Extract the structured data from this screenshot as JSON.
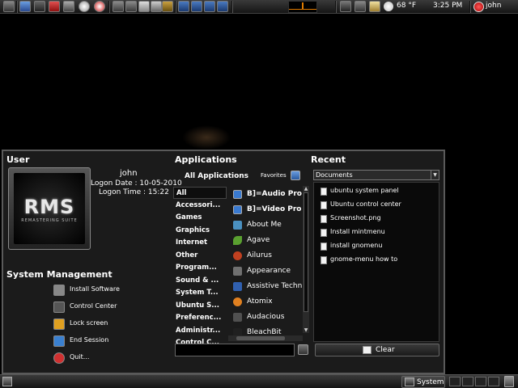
{
  "top_panel": {
    "icons": [
      "launcher-icon",
      "firefox-icon",
      "terminal-icon",
      "pdf-icon",
      "monitor-icon",
      "clock-app-icon",
      "opera-icon",
      "files-icon",
      "notes-icon",
      "editor-icon",
      "docs-icon",
      "mail-app-icon",
      "workspace-1-icon",
      "workspace-2-icon",
      "workspace-3-icon",
      "workspace-4-icon"
    ],
    "weather": "68 °F",
    "time": "3:25 PM",
    "user": "john"
  },
  "user_section": {
    "title": "User",
    "logo_text": "RMS",
    "logo_subtext": "REMASTERING SUITE",
    "name": "john",
    "logon_date": "Logon Date : 10-05-2010",
    "logon_time": "Logon Time : 15:22"
  },
  "system_management": {
    "title": "System Management",
    "items": [
      {
        "label": "Install Software",
        "icon": "install-software-icon",
        "color": "#888888"
      },
      {
        "label": "Control Center",
        "icon": "control-center-icon",
        "color": "#555555"
      },
      {
        "label": "Lock screen",
        "icon": "lock-icon",
        "color": "#e0a020"
      },
      {
        "label": "End Session",
        "icon": "end-session-icon",
        "color": "#3a80d0"
      },
      {
        "label": "Quit...",
        "icon": "quit-icon",
        "color": "#d03030"
      }
    ]
  },
  "applications": {
    "title": "Applications",
    "all_label": "All Applications",
    "favorites_label": "Favorites",
    "categories": [
      "All",
      "Accessori...",
      "Games",
      "Graphics",
      "Internet",
      "Other",
      "Program...",
      "Sound & ...",
      "System T...",
      "Ubuntu S...",
      "Preferenc...",
      "Administr...",
      "Control C..."
    ],
    "apps": [
      {
        "label": "B]=Audio Pro",
        "bold": true,
        "icon": "audio-pro-icon",
        "color": "#3a7ad0"
      },
      {
        "label": "B]=Video Pro",
        "bold": true,
        "icon": "video-pro-icon",
        "color": "#3a7ad0"
      },
      {
        "label": "About Me",
        "bold": false,
        "icon": "about-me-icon",
        "color": "#4a90c0"
      },
      {
        "label": "Agave",
        "bold": false,
        "icon": "agave-icon",
        "color": "#5aa030"
      },
      {
        "label": "Ailurus",
        "bold": false,
        "icon": "ailurus-icon",
        "color": "#c04020"
      },
      {
        "label": "Appearance",
        "bold": false,
        "icon": "appearance-icon",
        "color": "#707070"
      },
      {
        "label": "Assistive Techn",
        "bold": false,
        "icon": "assistive-tech-icon",
        "color": "#3060b0"
      },
      {
        "label": "Atomix",
        "bold": false,
        "icon": "atomix-icon",
        "color": "#e08020"
      },
      {
        "label": "Audacious",
        "bold": false,
        "icon": "audacious-icon",
        "color": "#505050"
      },
      {
        "label": "BleachBit",
        "bold": false,
        "icon": "bleachbit-icon",
        "color": "#202020"
      }
    ],
    "search_value": ""
  },
  "recent": {
    "title": "Recent",
    "filter": "Documents",
    "items": [
      "ubuntu system panel",
      "Ubuntu control center",
      "Screenshot.png",
      "Install mintmenu",
      "install gnomenu",
      "gnome-menu how to"
    ],
    "clear_label": "Clear"
  },
  "bottom_panel": {
    "system_label": "System"
  }
}
